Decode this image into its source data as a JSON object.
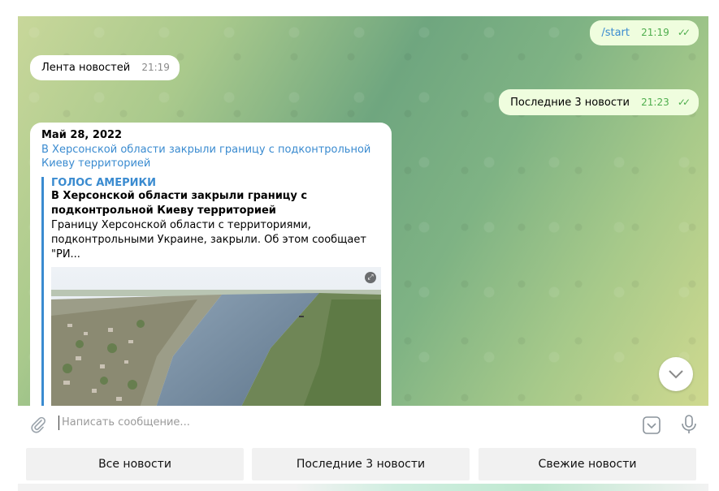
{
  "messages": {
    "start": {
      "text": "/start",
      "time": "21:19"
    },
    "lenta": {
      "text": "Лента новостей",
      "time": "21:19"
    },
    "last3": {
      "text": "Последние 3 новости",
      "time": "21:23"
    }
  },
  "news": {
    "date": "Май 28, 2022",
    "link": "В Херсонской области закрыли границу с подконтрольной Киеву территорией",
    "preview": {
      "site": "ГОЛОС АМЕРИКИ",
      "title": "В Херсонской области закрыли границу с подконтрольной Киеву территорией",
      "description": "Границу Херсонской области с территориями, подконтрольными Украине, закрыли. Об этом сообщает \"РИ..."
    }
  },
  "composer": {
    "placeholder": "Написать сообщение..."
  },
  "keyboard": [
    "Все новости",
    "Последние 3 новости",
    "Свежие новости"
  ],
  "icons": {
    "attach": "paperclip-icon",
    "emoji": "emoji-icon",
    "mic": "microphone-icon",
    "scroll": "chevron-down-icon",
    "read": "double-check-icon"
  },
  "colors": {
    "link": "#3a8bd0",
    "outgoing_bubble": "#effdde",
    "check": "#4fae4e"
  }
}
